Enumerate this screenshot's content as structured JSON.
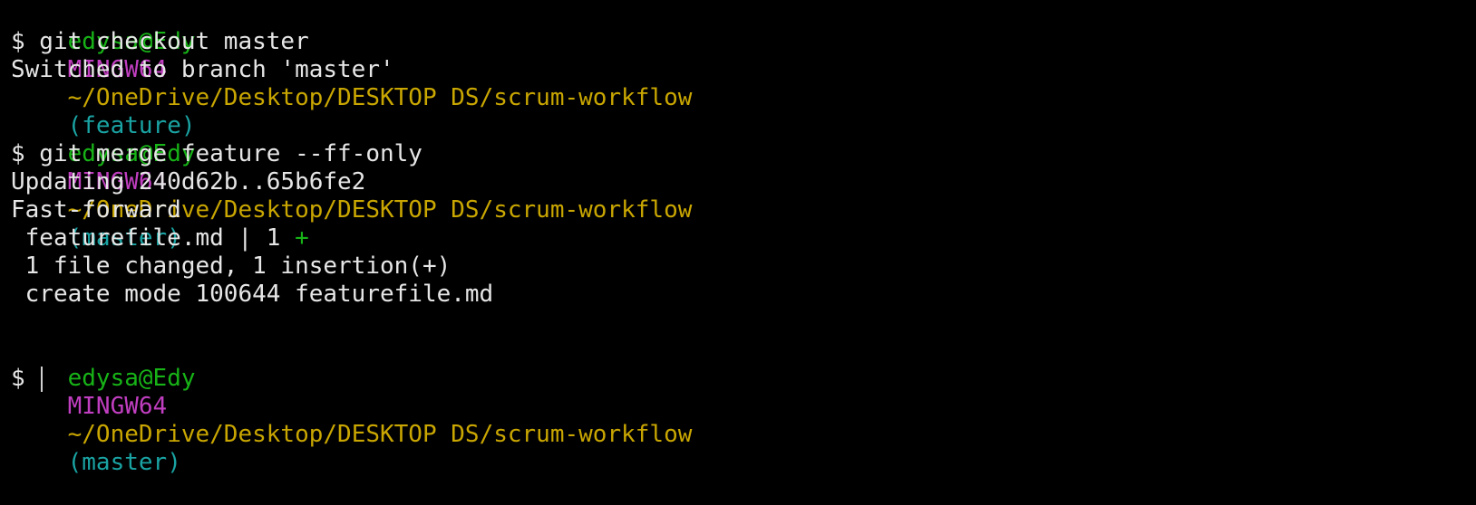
{
  "terminal": {
    "prompts": [
      {
        "user": "edysa@Edy",
        "host": "MINGW64",
        "path": "~/OneDrive/Desktop/DESKTOP DS/scrum-workflow",
        "branch": "(feature)"
      },
      {
        "user": "edysa@Edy",
        "host": "MINGW64",
        "path": "~/OneDrive/Desktop/DESKTOP DS/scrum-workflow",
        "branch": "(master)"
      },
      {
        "user": "edysa@Edy",
        "host": "MINGW64",
        "path": "~/OneDrive/Desktop/DESKTOP DS/scrum-workflow",
        "branch": "(master)"
      }
    ],
    "commands": [
      "$ git checkout master",
      "$ git merge feature --ff-only",
      "$ "
    ],
    "output": {
      "switched": "Switched to branch 'master'",
      "updating": "Updating 240d62b..65b6fe2",
      "fast_forward": "Fast-forward",
      "diffstat_file": " featurefile.md | 1 ",
      "diffstat_plus": "+",
      "summary": " 1 file changed, 1 insertion(+)",
      "create_mode": " create mode 100644 featurefile.md"
    }
  },
  "colors": {
    "background": "#000000",
    "user": "#17b317",
    "host": "#c03ec0",
    "path": "#c9a600",
    "branch": "#1aa3a3",
    "text": "#e6e6e6"
  }
}
